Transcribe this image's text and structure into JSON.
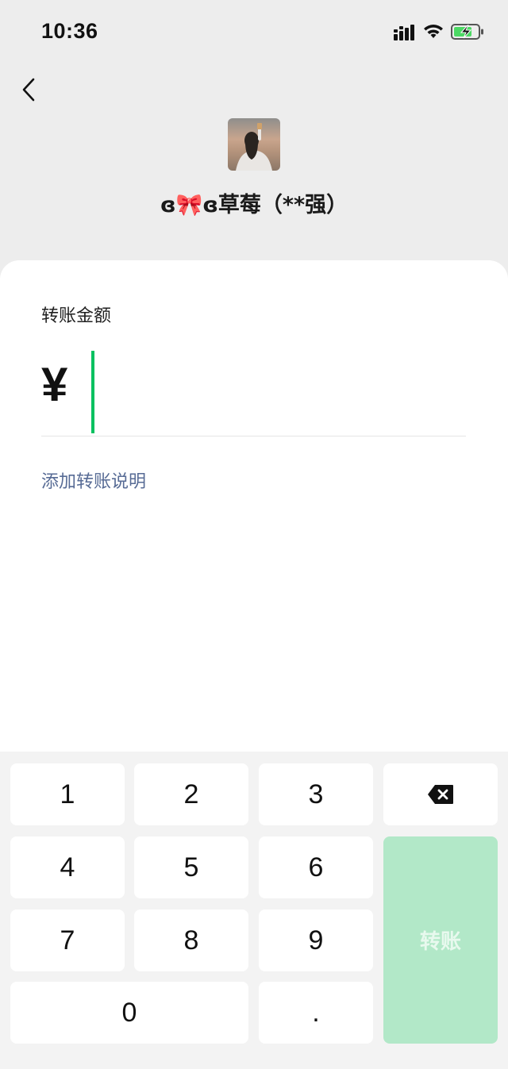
{
  "status_bar": {
    "time": "10:36"
  },
  "header": {
    "recipient_prefix": "ɞ",
    "recipient_bow": "🎀",
    "recipient_suffix": "ɞ草莓（**强）"
  },
  "card": {
    "amount_label": "转账金额",
    "currency_symbol": "¥",
    "amount_value": "",
    "add_note_label": "添加转账说明"
  },
  "keypad": {
    "keys": [
      "1",
      "2",
      "3",
      "4",
      "5",
      "6",
      "7",
      "8",
      "9",
      "0",
      "."
    ],
    "delete_icon": "backspace-icon",
    "transfer_label": "转账"
  },
  "colors": {
    "accent": "#07c160",
    "transfer_disabled": "#b2e8c8",
    "link": "#576b95",
    "background": "#ededed"
  }
}
